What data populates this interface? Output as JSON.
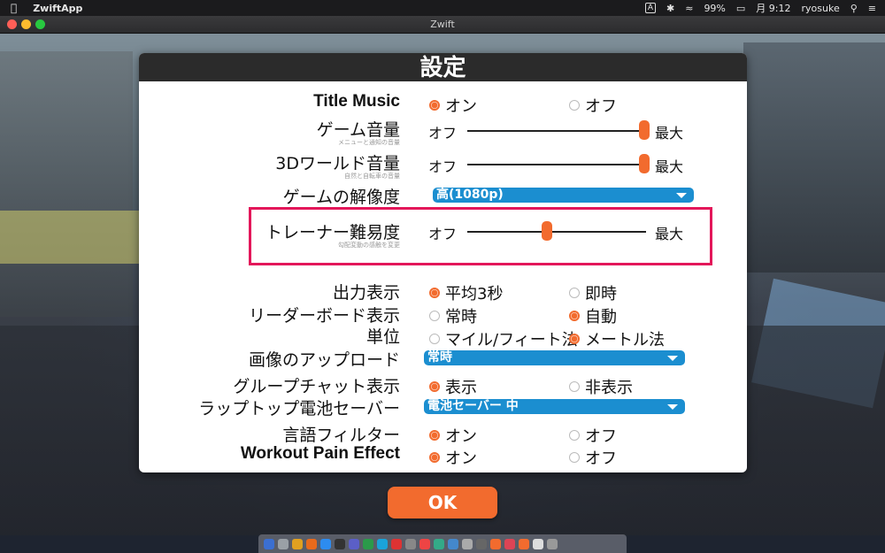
{
  "menubar": {
    "app_name": "ZwiftApp",
    "input_badge": "A",
    "battery": "99%",
    "clock": "月 9:12",
    "user": "ryosuke"
  },
  "window": {
    "title": "Zwift"
  },
  "dialog": {
    "title": "設定",
    "rows": {
      "title_music": {
        "label": "Title Music",
        "opt1": "オン",
        "opt2": "オフ",
        "selected": 1
      },
      "game_volume": {
        "label": "ゲーム音量",
        "sub": "メニューと通知の音量",
        "min": "オフ",
        "max": "最大",
        "value": 1.0
      },
      "world_volume": {
        "label": "3Dワールド音量",
        "sub": "自然と自転車の音量",
        "min": "オフ",
        "max": "最大",
        "value": 1.0
      },
      "resolution": {
        "label": "ゲームの解像度",
        "value": "高(1080p)"
      },
      "trainer": {
        "label": "トレーナー難易度",
        "sub": "勾配変動の感触を変更",
        "min": "オフ",
        "max": "最大",
        "value": 0.45
      },
      "power": {
        "label": "出力表示",
        "opt1": "平均3秒",
        "opt2": "即時",
        "selected": 1
      },
      "leaderboard": {
        "label": "リーダーボード表示",
        "opt1": "常時",
        "opt2": "自動",
        "selected": 2
      },
      "units": {
        "label": "単位",
        "opt1": "マイル/フィート法",
        "opt2": "メートル法",
        "selected": 2
      },
      "upload": {
        "label": "画像のアップロード",
        "value": "常時"
      },
      "group_chat": {
        "label": "グループチャット表示",
        "opt1": "表示",
        "opt2": "非表示",
        "selected": 1
      },
      "laptop_battery": {
        "label": "ラップトップ電池セーバー",
        "value": "電池セーバー 中"
      },
      "language_filter": {
        "label": "言語フィルター",
        "opt1": "オン",
        "opt2": "オフ",
        "selected": 1
      },
      "workout_pain": {
        "label": "Workout Pain Effect",
        "opt1": "オン",
        "opt2": "オフ",
        "selected": 1
      }
    },
    "ok_label": "OK"
  },
  "colors": {
    "accent": "#f26b2e",
    "dropdown": "#1b8ed0",
    "highlight": "#e3175a"
  }
}
